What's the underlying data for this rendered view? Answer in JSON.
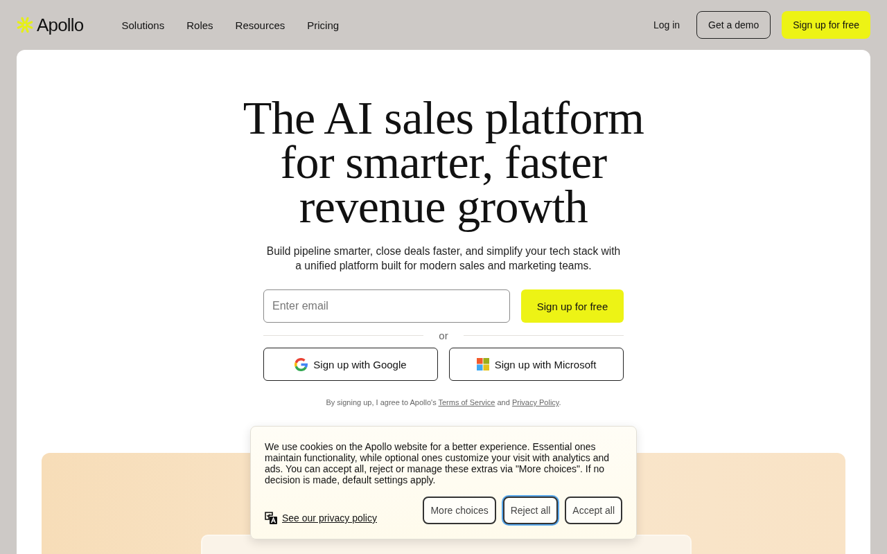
{
  "header": {
    "logo": "Apollo",
    "nav": [
      "Solutions",
      "Roles",
      "Resources",
      "Pricing"
    ],
    "login": "Log in",
    "demo_button": "Get a demo",
    "signup_button": "Sign up for free"
  },
  "hero": {
    "title": [
      "The AI sales platform",
      "for smarter, faster",
      "revenue growth"
    ],
    "subtitle": [
      "Build pipeline smarter, close deals faster, and simplify your tech stack with",
      "a unified platform built for modern sales and marketing teams."
    ],
    "email": {
      "placeholder": "Enter email"
    },
    "submit": "Sign up for free",
    "divider": "or",
    "social": [
      {
        "kind": "google",
        "label": "Sign up with Google"
      },
      {
        "kind": "microsoft",
        "label": "Sign up with Microsoft"
      }
    ],
    "legal": [
      {
        "kind": "text",
        "text": "By signing up, I agree to Apollo's "
      },
      {
        "kind": "link",
        "text": "Terms of Service"
      },
      {
        "kind": "text",
        "text": " and "
      },
      {
        "kind": "link",
        "text": "Privacy Policy"
      },
      {
        "kind": "text",
        "text": "."
      }
    ]
  },
  "cookie_banner": {
    "text": "We use cookies on the Apollo website for a better experience. Essential ones maintain functionality, while optional ones customize your visit with analytics and ads. You can accept all, reject or manage these extras via \"More choices\". If no decision is made, default settings apply.",
    "privacy_link": "See our privacy policy",
    "buttons": [
      {
        "label": "More choices",
        "focused": false
      },
      {
        "label": "Reject all",
        "focused": true
      },
      {
        "label": "Accept all",
        "focused": false
      }
    ]
  }
}
